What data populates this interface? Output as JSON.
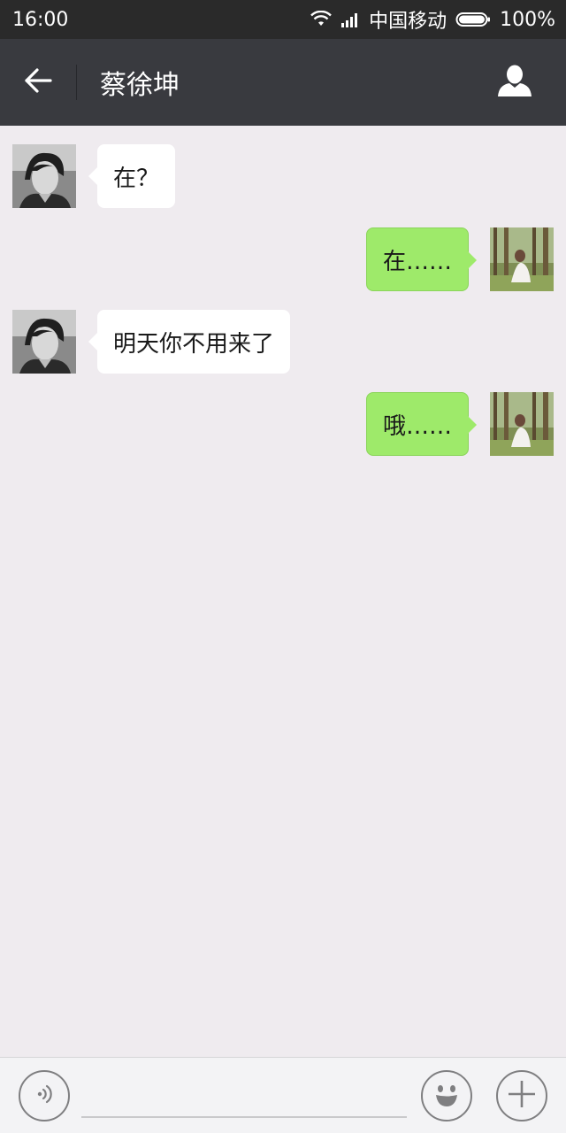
{
  "status_bar": {
    "time": "16:00",
    "carrier": "中国移动",
    "battery": "100%",
    "icons": [
      "wifi-icon",
      "signal-icon",
      "battery-icon"
    ]
  },
  "header": {
    "title": "蔡徐坤",
    "back_icon": "back-arrow-icon",
    "profile_icon": "person-icon"
  },
  "messages": [
    {
      "side": "left",
      "text": "在？"
    },
    {
      "side": "right",
      "text": "在……"
    },
    {
      "side": "left",
      "text": "明天你不用来了"
    },
    {
      "side": "right",
      "text": "哦……"
    }
  ],
  "input_bar": {
    "voice_icon": "voice-icon",
    "input_value": "",
    "emoji_icon": "emoji-icon",
    "plus_icon": "plus-icon"
  },
  "colors": {
    "background": "#efebef",
    "header": "#393a3f",
    "bubble_sent": "#9eea6a",
    "bubble_received": "#ffffff"
  }
}
